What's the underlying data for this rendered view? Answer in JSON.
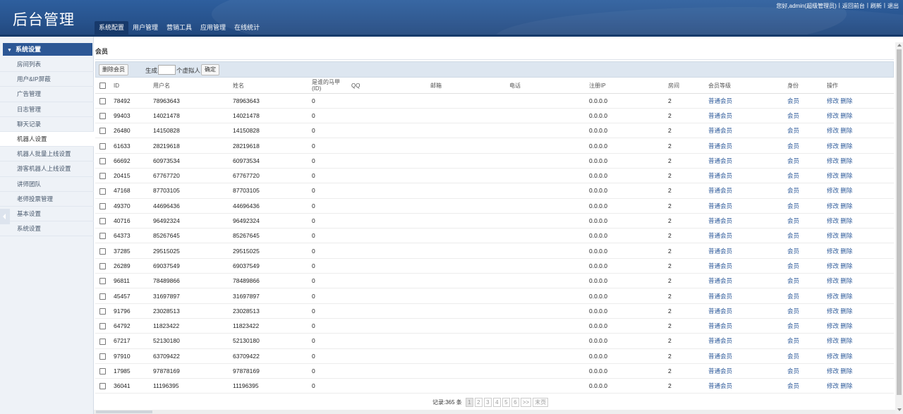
{
  "header": {
    "logo": "后台管理",
    "nav": [
      "系统配置",
      "用户管理",
      "营销工具",
      "应用管理",
      "在线统计"
    ],
    "user_greeting": "您好,admin(超级管理员)",
    "links": [
      "返回前台",
      "刷新",
      "退出"
    ],
    "separator": "|"
  },
  "sidebar": {
    "title": "系统设置",
    "items": [
      "房间列表",
      "用户&IP屏蔽",
      "广告管理",
      "日志管理",
      "聊天记录",
      "机器人设置",
      "机器人批量上线设置",
      "游客机器人上线设置",
      "讲师团队",
      "老师投票管理",
      "基本设置",
      "系统设置"
    ]
  },
  "main": {
    "crumb": "会员",
    "toolbar": {
      "delete_label": "删除会员",
      "generate_label": "生成",
      "generate_value": "",
      "generate_suffix": "个虚拟人",
      "confirm_label": "确定"
    },
    "table": {
      "headers": [
        "ID",
        "用户名",
        "姓名",
        "是谁的马甲(ID)",
        "QQ",
        "邮箱",
        "电话",
        "注册IP",
        "房间",
        "会员等级",
        "身份",
        "操作"
      ],
      "rows": [
        {
          "id": "78492",
          "username": "78963643",
          "name": "78963643",
          "vest": "0",
          "ip": "0.0.0.0",
          "room": "2",
          "level": "普通会员",
          "role": "会员"
        },
        {
          "id": "99403",
          "username": "14021478",
          "name": "14021478",
          "vest": "0",
          "ip": "0.0.0.0",
          "room": "2",
          "level": "普通会员",
          "role": "会员"
        },
        {
          "id": "26480",
          "username": "14150828",
          "name": "14150828",
          "vest": "0",
          "ip": "0.0.0.0",
          "room": "2",
          "level": "普通会员",
          "role": "会员"
        },
        {
          "id": "61633",
          "username": "28219618",
          "name": "28219618",
          "vest": "0",
          "ip": "0.0.0.0",
          "room": "2",
          "level": "普通会员",
          "role": "会员"
        },
        {
          "id": "66692",
          "username": "60973534",
          "name": "60973534",
          "vest": "0",
          "ip": "0.0.0.0",
          "room": "2",
          "level": "普通会员",
          "role": "会员"
        },
        {
          "id": "20415",
          "username": "67767720",
          "name": "67767720",
          "vest": "0",
          "ip": "0.0.0.0",
          "room": "2",
          "level": "普通会员",
          "role": "会员"
        },
        {
          "id": "47168",
          "username": "87703105",
          "name": "87703105",
          "vest": "0",
          "ip": "0.0.0.0",
          "room": "2",
          "level": "普通会员",
          "role": "会员"
        },
        {
          "id": "49370",
          "username": "44696436",
          "name": "44696436",
          "vest": "0",
          "ip": "0.0.0.0",
          "room": "2",
          "level": "普通会员",
          "role": "会员"
        },
        {
          "id": "40716",
          "username": "96492324",
          "name": "96492324",
          "vest": "0",
          "ip": "0.0.0.0",
          "room": "2",
          "level": "普通会员",
          "role": "会员"
        },
        {
          "id": "64373",
          "username": "85267645",
          "name": "85267645",
          "vest": "0",
          "ip": "0.0.0.0",
          "room": "2",
          "level": "普通会员",
          "role": "会员"
        },
        {
          "id": "37285",
          "username": "29515025",
          "name": "29515025",
          "vest": "0",
          "ip": "0.0.0.0",
          "room": "2",
          "level": "普通会员",
          "role": "会员"
        },
        {
          "id": "26289",
          "username": "69037549",
          "name": "69037549",
          "vest": "0",
          "ip": "0.0.0.0",
          "room": "2",
          "level": "普通会员",
          "role": "会员"
        },
        {
          "id": "96811",
          "username": "78489866",
          "name": "78489866",
          "vest": "0",
          "ip": "0.0.0.0",
          "room": "2",
          "level": "普通会员",
          "role": "会员"
        },
        {
          "id": "45457",
          "username": "31697897",
          "name": "31697897",
          "vest": "0",
          "ip": "0.0.0.0",
          "room": "2",
          "level": "普通会员",
          "role": "会员"
        },
        {
          "id": "91796",
          "username": "23028513",
          "name": "23028513",
          "vest": "0",
          "ip": "0.0.0.0",
          "room": "2",
          "level": "普通会员",
          "role": "会员"
        },
        {
          "id": "64792",
          "username": "11823422",
          "name": "11823422",
          "vest": "0",
          "ip": "0.0.0.0",
          "room": "2",
          "level": "普通会员",
          "role": "会员"
        },
        {
          "id": "67217",
          "username": "52130180",
          "name": "52130180",
          "vest": "0",
          "ip": "0.0.0.0",
          "room": "2",
          "level": "普通会员",
          "role": "会员"
        },
        {
          "id": "97910",
          "username": "63709422",
          "name": "63709422",
          "vest": "0",
          "ip": "0.0.0.0",
          "room": "2",
          "level": "普通会员",
          "role": "会员"
        },
        {
          "id": "17985",
          "username": "97878169",
          "name": "97878169",
          "vest": "0",
          "ip": "0.0.0.0",
          "room": "2",
          "level": "普通会员",
          "role": "会员"
        },
        {
          "id": "36041",
          "username": "11196395",
          "name": "11196395",
          "vest": "0",
          "ip": "0.0.0.0",
          "room": "2",
          "level": "普通会员",
          "role": "会员"
        }
      ],
      "edit_label": "修改",
      "delete_label": "删除"
    },
    "pager": {
      "total": "记录:365 条",
      "pages": [
        "1",
        "2",
        "3",
        "4",
        "5",
        "6"
      ],
      "current": "1",
      "next": ">>",
      "last": "末页"
    }
  }
}
